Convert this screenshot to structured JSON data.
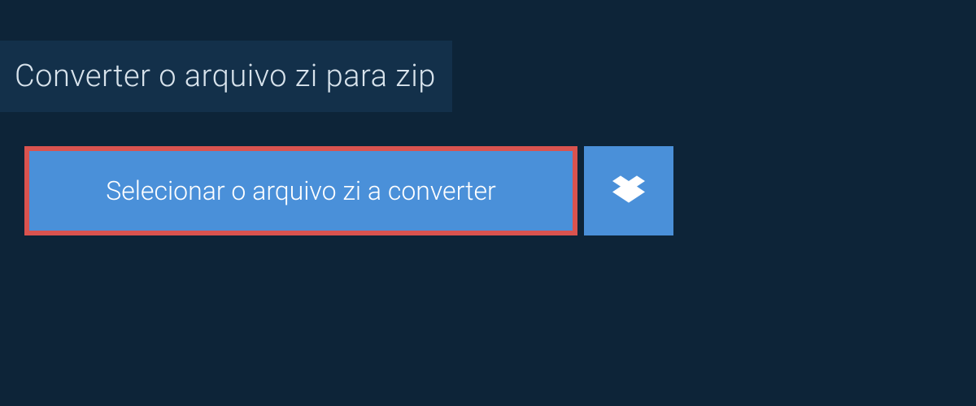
{
  "header": {
    "title": "Converter o arquivo zi para zip"
  },
  "actions": {
    "select_file_label": "Selecionar o arquivo zi a converter"
  },
  "colors": {
    "page_bg": "#0d2438",
    "header_bg": "#13304a",
    "button_bg": "#4a90d9",
    "highlight_border": "#d9534f",
    "text_light": "#d8e3ec",
    "text_white": "#ffffff"
  }
}
